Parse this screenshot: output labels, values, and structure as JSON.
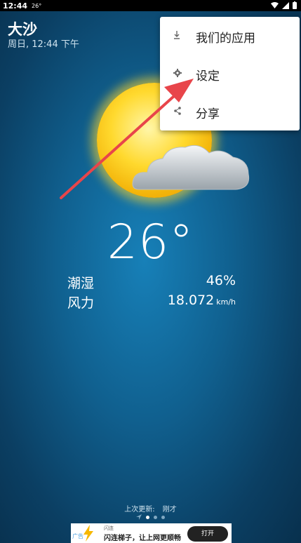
{
  "status_bar": {
    "time": "12:44",
    "temp": "26°"
  },
  "location": {
    "city": "大沙",
    "datetime": "周日, 12:44 下午"
  },
  "weather": {
    "temperature": "26°",
    "humidity_label": "潮湿",
    "humidity_value": "46%",
    "wind_label": "风力",
    "wind_value": "18.072",
    "wind_unit": "km/h"
  },
  "footer": {
    "last_update_label": "上次更新:",
    "last_update_value": "刚才",
    "page_count": 3,
    "active_page": 0
  },
  "ad": {
    "tag": "广告",
    "name": "闪连",
    "text": "闪连梯子，让上网更顺畅",
    "button": "打开"
  },
  "menu": {
    "items": [
      {
        "label": "我们的应用",
        "icon": "download-icon"
      },
      {
        "label": "设定",
        "icon": "gear-icon"
      },
      {
        "label": "分享",
        "icon": "share-icon"
      }
    ]
  },
  "colors": {
    "background": "#10608f",
    "sun": "#ffd92e",
    "arrow": "#e8454a",
    "menu_bg": "#ffffff"
  }
}
